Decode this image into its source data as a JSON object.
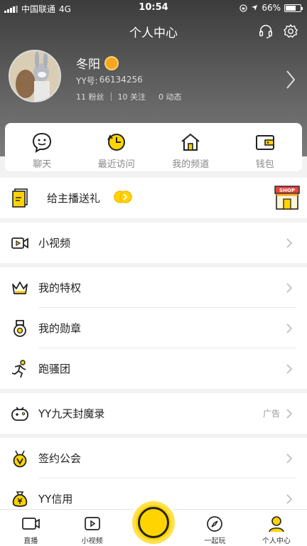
{
  "status_bar": {
    "carrier": "中国联通",
    "network": "4G",
    "time": "10:54",
    "battery": "66%"
  },
  "header": {
    "title": "个人中心",
    "icons": [
      "headset-icon",
      "settings-icon"
    ]
  },
  "profile": {
    "name": "冬阳",
    "yy_label": "YY号:",
    "yy_number": "66134256",
    "stats": [
      {
        "value": "11",
        "label": "粉丝"
      },
      {
        "value": "10",
        "label": "关注"
      },
      {
        "value": "0",
        "label": "动态"
      }
    ]
  },
  "quick_actions": [
    {
      "label": "聊天",
      "icon": "chat-icon"
    },
    {
      "label": "最近访问",
      "icon": "clock-icon"
    },
    {
      "label": "我的频道",
      "icon": "home-icon"
    },
    {
      "label": "钱包",
      "icon": "wallet-icon"
    }
  ],
  "gift_banner": {
    "label": "给主播送礼",
    "shop_text": "SHOP"
  },
  "menu": {
    "short_video": "小视频",
    "privilege": "我的特权",
    "medal": "我的勋章",
    "run_club": "跑骚团",
    "game": "YY九天封魔录",
    "game_tag": "广告",
    "guild": "签约公会",
    "credit": "YY信用"
  },
  "tabs": [
    {
      "label": "直播",
      "icon": "live-tv-icon"
    },
    {
      "label": "小视频",
      "icon": "video-icon"
    },
    {
      "label": "",
      "icon": "record-button-icon"
    },
    {
      "label": "一起玩",
      "icon": "compass-icon"
    },
    {
      "label": "个人中心",
      "icon": "profile-icon"
    }
  ],
  "colors": {
    "accent": "#FFD400",
    "header_bg": "#4a4a4a"
  }
}
